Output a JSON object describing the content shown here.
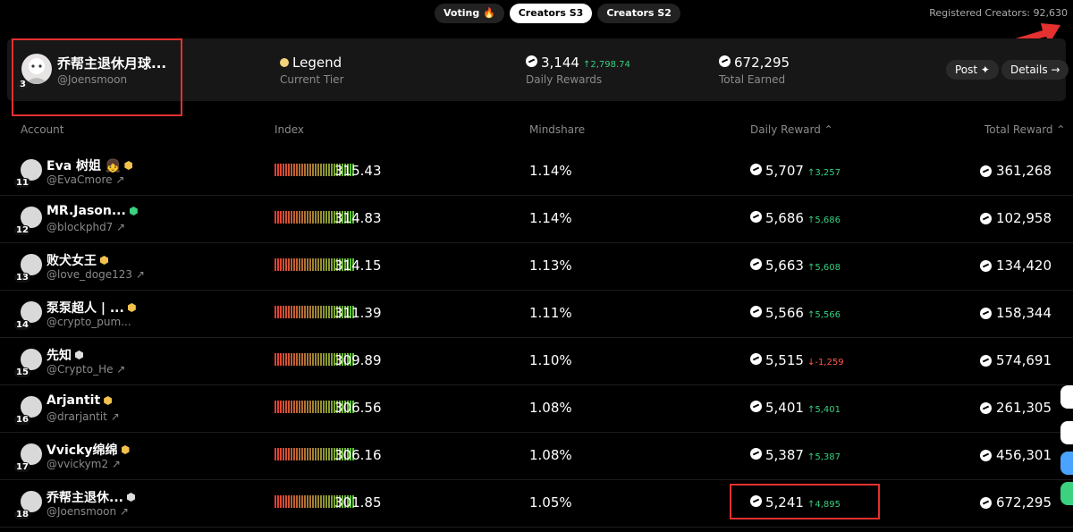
{
  "tabs": [
    {
      "label": "Voting 🔥",
      "active": false
    },
    {
      "label": "Creators S3",
      "active": true
    },
    {
      "label": "Creators S2",
      "active": false
    }
  ],
  "registered": "Registered Creators: 92,630",
  "highlight": {
    "rank": "3",
    "name": "乔帮主退休月球...",
    "handle": "@Joensmoon",
    "tier_value": "Legend",
    "tier_label": "Current Tier",
    "daily_value": "3,144",
    "daily_change": "↑2,798.74",
    "daily_label": "Daily Rewards",
    "total_value": "672,295",
    "total_label": "Total Earned",
    "post_label": "Post ✦",
    "details_label": "Details →"
  },
  "headers": {
    "account": "Account",
    "index": "Index",
    "mindshare": "Mindshare",
    "daily": "Daily Reward ⌃",
    "total": "Total Reward ⌃"
  },
  "rows": [
    {
      "rank": "11",
      "name": "Eva 树姐 👧",
      "handle": "@EvaCmore ↗",
      "badge": "y",
      "index": "315.43",
      "mindshare": "1.14%",
      "daily": "5,707",
      "change": "↑3,257",
      "dir": "up",
      "total": "361,268"
    },
    {
      "rank": "12",
      "name": "MR.Jason...",
      "handle": "@blockphd7 ↗",
      "badge": "g",
      "index": "314.83",
      "mindshare": "1.14%",
      "daily": "5,686",
      "change": "↑5,686",
      "dir": "up",
      "total": "102,958"
    },
    {
      "rank": "13",
      "name": "败犬女王",
      "handle": "@love_doge123 ↗",
      "badge": "y",
      "index": "314.15",
      "mindshare": "1.13%",
      "daily": "5,663",
      "change": "↑5,608",
      "dir": "up",
      "total": "134,420"
    },
    {
      "rank": "14",
      "name": "泵泵超人 | ...",
      "handle": "@crypto_pum...",
      "badge": "y",
      "index": "311.39",
      "mindshare": "1.11%",
      "daily": "5,566",
      "change": "↑5,566",
      "dir": "up",
      "total": "158,344"
    },
    {
      "rank": "15",
      "name": "先知",
      "handle": "@Crypto_He ↗",
      "badge": "w",
      "index": "309.89",
      "mindshare": "1.10%",
      "daily": "5,515",
      "change": "↓-1,259",
      "dir": "down",
      "total": "574,691"
    },
    {
      "rank": "16",
      "name": "Arjantit",
      "handle": "@drarjantit ↗",
      "badge": "y",
      "index": "306.56",
      "mindshare": "1.08%",
      "daily": "5,401",
      "change": "↑5,401",
      "dir": "up",
      "total": "261,305"
    },
    {
      "rank": "17",
      "name": "Vvicky绵绵",
      "handle": "@vvickym2 ↗",
      "badge": "y",
      "index": "306.16",
      "mindshare": "1.08%",
      "daily": "5,387",
      "change": "↑5,387",
      "dir": "up",
      "total": "456,301"
    },
    {
      "rank": "18",
      "name": "乔帮主退休...",
      "handle": "@Joensmoon ↗",
      "badge": "w",
      "index": "301.85",
      "mindshare": "1.05%",
      "daily": "5,241",
      "change": "↑4,895",
      "dir": "up",
      "total": "672,295"
    }
  ],
  "colors": {
    "accent_up": "#35d07f",
    "accent_down": "#ff5a4a",
    "annotation": "#e53030"
  }
}
